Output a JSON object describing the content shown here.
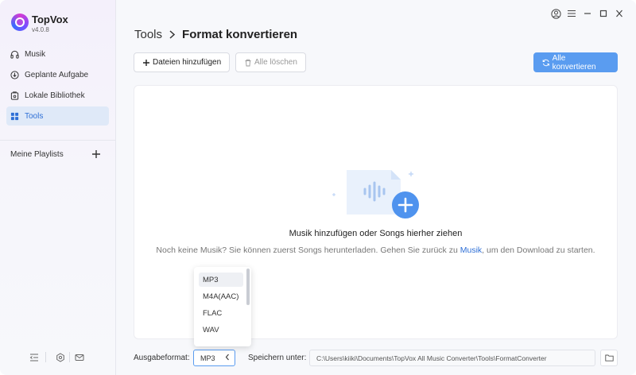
{
  "app": {
    "name": "TopVox",
    "version": "v4.0.8"
  },
  "sidebar": {
    "items": [
      {
        "label": "Musik",
        "icon": "headphones-icon"
      },
      {
        "label": "Geplante Aufgabe",
        "icon": "download-icon"
      },
      {
        "label": "Lokale Bibliothek",
        "icon": "library-icon"
      },
      {
        "label": "Tools",
        "icon": "grid-icon",
        "active": true
      }
    ],
    "playlists_label": "Meine Playlists"
  },
  "breadcrumb": {
    "parent": "Tools",
    "current": "Format konvertieren"
  },
  "toolbar": {
    "add_label": "Dateien hinzufügen",
    "clear_label": "Alle löschen",
    "convert_label": "Alle konvertieren"
  },
  "dropzone": {
    "title": "Musik hinzufügen oder Songs hierher ziehen",
    "subtitle_before": "Noch keine Musik? Sie können zuerst Songs herunterladen. Gehen Sie zurück zu ",
    "subtitle_link": "Musik",
    "subtitle_after": ", um den Download zu starten."
  },
  "bottom": {
    "format_label": "Ausgabeformat:",
    "format_value": "MP3",
    "save_label": "Speichern unter:",
    "save_path": "C:\\Users\\kiiki\\Documents\\TopVox All Music Converter\\Tools\\FormatConverter"
  },
  "format_options": [
    "MP3",
    "M4A(AAC)",
    "FLAC",
    "WAV"
  ],
  "colors": {
    "accent": "#5a9cf0",
    "link": "#2e6fd6",
    "active_bg": "#dfe9f8"
  }
}
